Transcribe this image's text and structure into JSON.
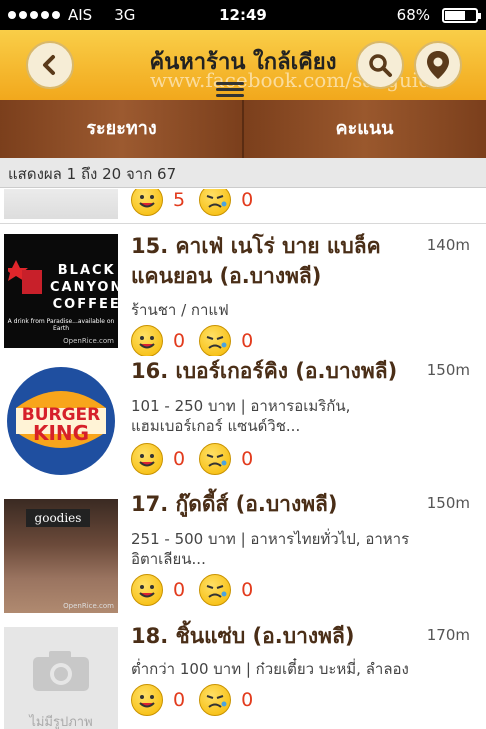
{
  "status": {
    "carrier": "AIS",
    "network": "3G",
    "time": "12:49",
    "battery": "68%",
    "battery_level": 0.68
  },
  "header": {
    "title": "ค้นหาร้าน ใกล้เคียง",
    "watermark": "www.facebook.com/saoguide"
  },
  "tabs": [
    {
      "label": "ระยะทาง"
    },
    {
      "label": "คะแนน"
    }
  ],
  "results": {
    "text": "แสดงผล 1 ถึง 20 จาก 67"
  },
  "partial_item": {
    "good": "5",
    "bad": "0"
  },
  "items": [
    {
      "name": "15. คาเฟ่ เนโร่ บาย แบล็ค แคนยอน (อ.บางพลี)",
      "distance": "140m",
      "desc": "ร้านชา / กาแฟ",
      "good": "0",
      "bad": "0",
      "logo": {
        "line1": "BLACK",
        "line2": "CANYON",
        "line3": "COFFEE",
        "tagline": "A drink from Paradise...available on Earth",
        "watermark": "OpenRice.com"
      }
    },
    {
      "name": "16. เบอร์เกอร์คิง (อ.บางพลี)",
      "distance": "150m",
      "desc": "101 - 250 บาท | อาหารอเมริกัน, แฮมเบอร์เกอร์ แซนด์วิช...",
      "good": "0",
      "bad": "0",
      "logo": {
        "line1": "BURGER",
        "line2": "KING"
      }
    },
    {
      "name": "17. กู๊ดดี้ส์ (อ.บางพลี)",
      "distance": "150m",
      "desc": "251 - 500 บาท | อาหารไทยทั่วไป, อาหารอิตาเลียน...",
      "good": "0",
      "bad": "0",
      "logo": {
        "sign": "goodies",
        "watermark": "OpenRice.com"
      }
    },
    {
      "name": "18. ชิ้นแซ่บ (อ.บางพลี)",
      "distance": "170m",
      "desc": "ต่ำกว่า 100 บาท | ก๋วยเตี๋ยว บะหมี่, ลำลอง",
      "good": "0",
      "bad": "0",
      "logo": {
        "no_image": "ไม่มีรูปภาพ"
      }
    }
  ],
  "colors": {
    "header": "#f2a81c",
    "tabs": "#8b4a24",
    "count": "#e23b1d",
    "name": "#4a2e17"
  }
}
